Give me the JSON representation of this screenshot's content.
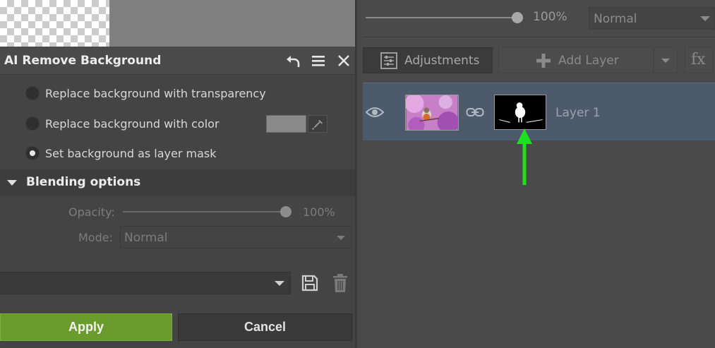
{
  "tool_panel": {
    "title": "AI Remove Background",
    "header_icons": [
      "undo-icon",
      "menu-icon",
      "close-icon"
    ],
    "options": [
      {
        "label": "Replace background with transparency",
        "selected": false
      },
      {
        "label": "Replace background with color",
        "selected": false
      },
      {
        "label": "Set background as layer mask",
        "selected": true
      }
    ],
    "blending": {
      "title": "Blending options",
      "opacity_label": "Opacity:",
      "opacity_value": "100%",
      "opacity_level": 1.0,
      "mode_label": "Mode:",
      "mode_value": "Normal"
    },
    "preset": {
      "value": ""
    },
    "apply_label": "Apply",
    "cancel_label": "Cancel"
  },
  "layers_panel": {
    "opacity_value": "100%",
    "opacity_level": 1.0,
    "blend_mode": "Normal",
    "adjustments_label": "Adjustments",
    "add_layer_label": "Add Layer",
    "fx_label": "fx",
    "layers": [
      {
        "name": "Layer 1",
        "visible": true,
        "has_mask": true
      }
    ]
  },
  "colors": {
    "apply_green": "#6b9b2c",
    "selected_layer": "#4d5a6b",
    "annotation_arrow": "#1fe01f"
  }
}
